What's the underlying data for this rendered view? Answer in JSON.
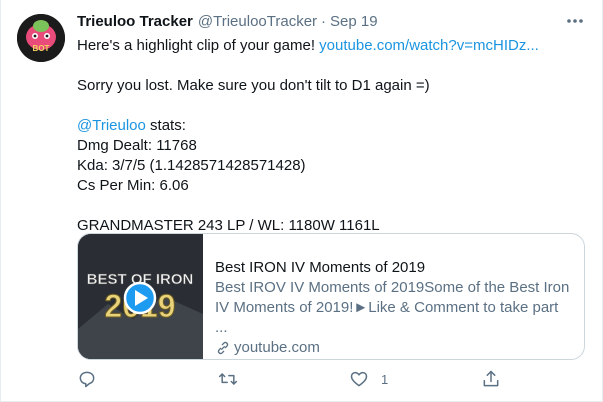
{
  "tweet": {
    "author_name": "Trieuloo Tracker",
    "author_handle": "@TrieulooTracker",
    "separator": "·",
    "date": "Sep 19",
    "avatar_label": "BOT",
    "more_icon": "more-horizontal-icon"
  },
  "body": {
    "line1_text": "Here's a highlight clip of your game! ",
    "line1_link": "youtube.com/watch?v=mcHIDz...",
    "line2": "Sorry you lost. Make sure you don't tilt to D1 again =)",
    "mention": "@Trieuloo",
    "mention_suffix": " stats:",
    "dmg": "Dmg Dealt: 11768",
    "kda": "Kda: 3/7/5 (1.1428571428571428)",
    "cs": "Cs Per Min: 6.06",
    "rank": "GRANDMASTER 243 LP / WL: 1180W 1161L"
  },
  "card": {
    "thumb_text_top": "BEST OF IRON",
    "thumb_text_year": "2019",
    "title": "Best IRON IV Moments of 2019",
    "desc_line1": "Best IROV IV Moments of 2019Some of the Best Iron",
    "desc_line2": "IV Moments of 2019!►Like & Comment to take part ...",
    "domain": "youtube.com"
  },
  "actions": {
    "reply_icon": "reply-icon",
    "retweet_icon": "retweet-icon",
    "like_icon": "heart-icon",
    "like_count": "1",
    "share_icon": "share-icon"
  },
  "colors": {
    "link": "#1b95e0",
    "muted": "#5b7083",
    "text": "#0f1419",
    "border": "#ccd6dd"
  }
}
